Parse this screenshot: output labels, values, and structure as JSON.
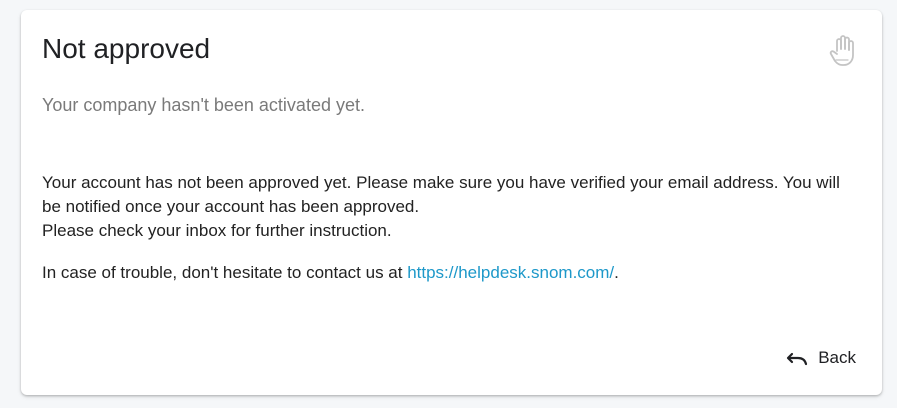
{
  "card": {
    "title": "Not approved",
    "subtitle": "Your company hasn't been activated yet.",
    "icon": "hand-stop-icon",
    "message_line1": "Your account has not been approved yet. Please make sure you have verified your email address. You will be notified once your account has been approved.",
    "message_line2": "Please check your inbox for further instruction.",
    "trouble_prefix": "In case of trouble, don't hesitate to contact us at ",
    "helpdesk_link": "https://helpdesk.snom.com/",
    "trouble_suffix": ".",
    "back_label": "Back",
    "back_icon": "undo-arrow-icon"
  },
  "colors": {
    "link": "#1d98c9",
    "subtitle": "#7a7a7a",
    "icon_muted": "#c9c9c9"
  }
}
